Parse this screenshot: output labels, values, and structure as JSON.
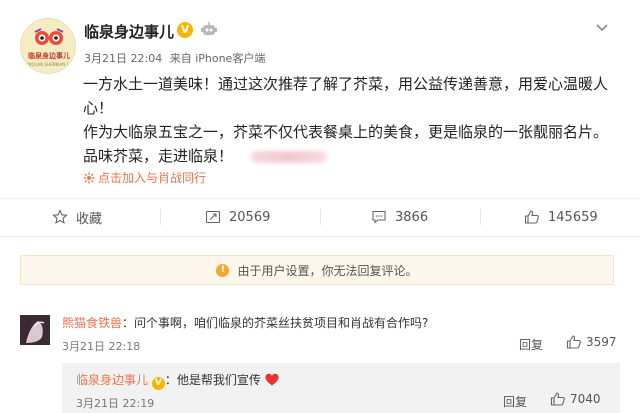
{
  "post": {
    "author": "临泉身边事儿",
    "verified_badge": "V",
    "avatar_logo_text": "临泉身边事儿",
    "avatar_logo_sub": "LINQUAN SHENBIAN SHIER",
    "date": "3月21日 22:04",
    "source": "来自 iPhone客户端",
    "body_line1": "一方水土一道美味！通过这次推荐了解了芥菜，用公益传递善意，用爱心温暖人心！",
    "body_line2": "作为大临泉五宝之一，芥菜不仅代表餐桌上的美食，更是临泉的一张靓丽名片。",
    "body_line3": "品味芥菜，走进临泉！",
    "topic_text": "点击加入",
    "topic_link": "与肖战同行",
    "icons": {
      "verified": "verified-v-icon",
      "vip": "vip-robot-icon",
      "more": "chevron-down-icon",
      "topic": "spark-icon"
    }
  },
  "actions": {
    "favorite": "收藏",
    "repost_count": "20569",
    "comment_count": "3866",
    "like_count": "145659"
  },
  "notice": {
    "text": "由于用户设置，你无法回复评论。"
  },
  "comment": {
    "name": "熊猫食铁兽",
    "separator": "：",
    "text": "问个事啊，咱们临泉的芥菜丝扶贫项目和肖战有合作吗?",
    "time": "3月21日 22:18",
    "reply_label": "回复",
    "like_count": "3597"
  },
  "reply": {
    "name": "临泉身边事儿",
    "verified_badge": "V",
    "separator": "：",
    "text": "他是帮我们宣传",
    "time": "3月21日 22:19",
    "reply_label": "回复",
    "like_count": "7040"
  },
  "colors": {
    "accent": "#eb7350",
    "verified": "#f7b500",
    "notice_bg": "#fdf6ec",
    "heart": "#e8332f"
  }
}
